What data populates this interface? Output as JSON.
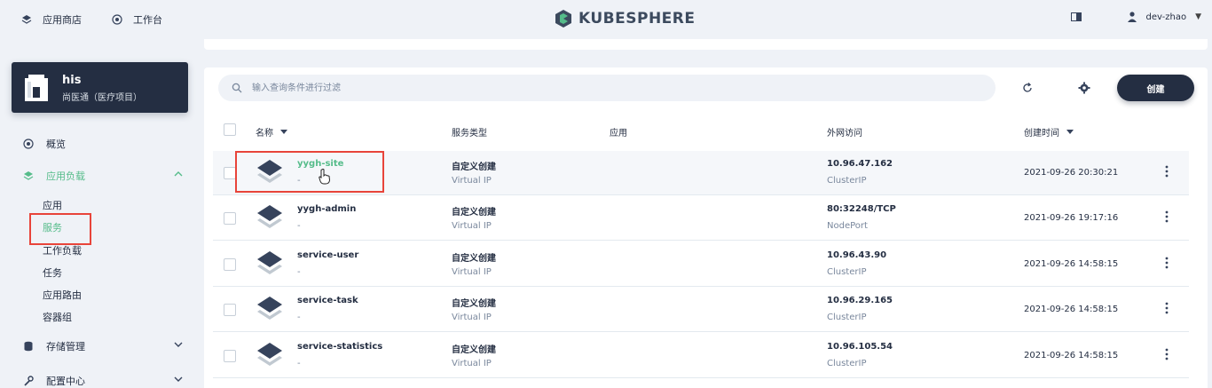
{
  "topbar": {
    "app_store": "应用商店",
    "workbench": "工作台",
    "logo_text": "KUBESPHERE",
    "user": "dev-zhao"
  },
  "project": {
    "name": "his",
    "desc": "尚医通（医疗项目）"
  },
  "nav": {
    "overview": "概览",
    "workloads": "应用负载",
    "sub": [
      "应用",
      "服务",
      "工作负载",
      "任务",
      "应用路由",
      "容器组"
    ],
    "storage": "存储管理",
    "config": "配置中心"
  },
  "toolbar": {
    "search_placeholder": "输入查询条件进行过滤",
    "create_label": "创建"
  },
  "table": {
    "headers": {
      "name": "名称",
      "service_type": "服务类型",
      "app": "应用",
      "external_access": "外网访问",
      "created": "创建时间"
    },
    "rows": [
      {
        "name": "yygh-site",
        "desc": "-",
        "type": "自定义创建",
        "ip_type": "Virtual IP",
        "access": "10.96.47.162",
        "access_type": "ClusterIP",
        "time": "2021-09-26 20:30:21"
      },
      {
        "name": "yygh-admin",
        "desc": "-",
        "type": "自定义创建",
        "ip_type": "Virtual IP",
        "access": "80:32248/TCP",
        "access_type": "NodePort",
        "time": "2021-09-26 19:17:16"
      },
      {
        "name": "service-user",
        "desc": "-",
        "type": "自定义创建",
        "ip_type": "Virtual IP",
        "access": "10.96.43.90",
        "access_type": "ClusterIP",
        "time": "2021-09-26 14:58:15"
      },
      {
        "name": "service-task",
        "desc": "-",
        "type": "自定义创建",
        "ip_type": "Virtual IP",
        "access": "10.96.29.165",
        "access_type": "ClusterIP",
        "time": "2021-09-26 14:58:15"
      },
      {
        "name": "service-statistics",
        "desc": "-",
        "type": "自定义创建",
        "ip_type": "Virtual IP",
        "access": "10.96.105.54",
        "access_type": "ClusterIP",
        "time": "2021-09-26 14:58:15"
      }
    ]
  },
  "colors": {
    "accent": "#55bc8a",
    "dark": "#242e42",
    "highlight": "#e8443a"
  }
}
